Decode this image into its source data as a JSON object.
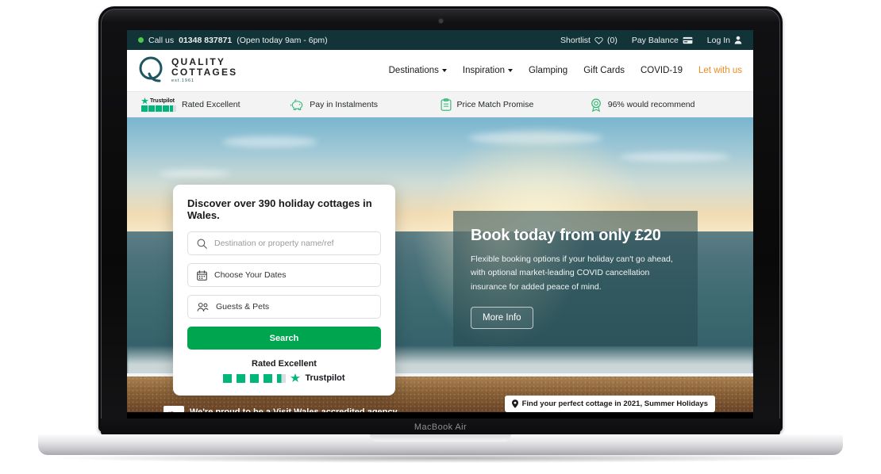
{
  "device": {
    "label": "MacBook Air"
  },
  "topbar": {
    "call_prefix": "Call us",
    "phone": "01348 837871",
    "hours": "(Open today 9am - 6pm)",
    "shortlist_label": "Shortlist",
    "shortlist_count": "(0)",
    "pay_balance": "Pay Balance",
    "log_in": "Log In"
  },
  "header": {
    "logo_line1": "QUALITY",
    "logo_line2": "COTTAGES",
    "logo_est": "est.1961",
    "nav": [
      {
        "label": "Destinations",
        "dropdown": true,
        "accent": false
      },
      {
        "label": "Inspiration",
        "dropdown": true,
        "accent": false
      },
      {
        "label": "Glamping",
        "dropdown": false,
        "accent": false
      },
      {
        "label": "Gift Cards",
        "dropdown": false,
        "accent": false
      },
      {
        "label": "COVID-19",
        "dropdown": false,
        "accent": false
      },
      {
        "label": "Let with us",
        "dropdown": false,
        "accent": true
      }
    ]
  },
  "usp": {
    "trustpilot_name": "Trustpilot",
    "items": [
      {
        "label": "Rated Excellent",
        "icon": "trustpilot-icon"
      },
      {
        "label": "Pay in Instalments",
        "icon": "piggy-bank-icon"
      },
      {
        "label": "Price Match Promise",
        "icon": "clipboard-icon"
      },
      {
        "label": "96% would recommend",
        "icon": "rosette-icon"
      }
    ]
  },
  "search_card": {
    "title": "Discover over 390 holiday cottages in Wales.",
    "destination_placeholder": "Destination or property name/ref",
    "dates_label": "Choose Your Dates",
    "guests_label": "Guests & Pets",
    "search_button": "Search",
    "rated_label": "Rated Excellent",
    "trustpilot_name": "Trustpilot"
  },
  "promo": {
    "heading": "Book today from only £20",
    "body": "Flexible booking options if your holiday can't go ahead, with optional market-leading COVID cancellation insurance for added peace of mind.",
    "button": "More Info"
  },
  "bottom": {
    "pin_badge": "Find your perfect cottage in 2021, Summer Holidays",
    "wales_text": "We're proud to be a Visit Wales accredited agency"
  },
  "colors": {
    "topbar_bg": "#123438",
    "accent_orange": "#ef8a1f",
    "search_green": "#00a550",
    "trustpilot_green": "#00b67a",
    "logo_teal": "#1d5560"
  }
}
